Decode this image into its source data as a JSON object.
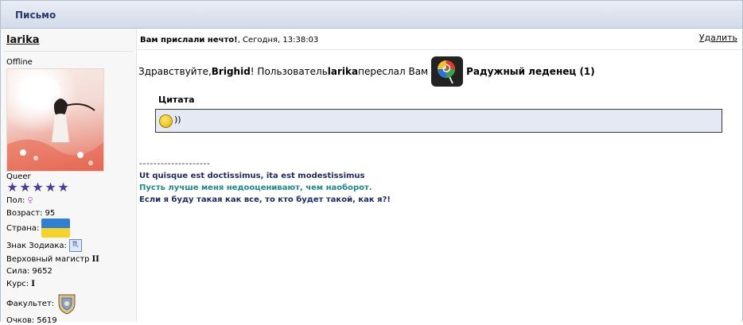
{
  "panel": {
    "title": "Письмо"
  },
  "sender": {
    "username": "larika",
    "status": "Offline",
    "rank": "Queer",
    "stars_count": 5,
    "gender_label": "Пол:",
    "gender_icon": "female-sign",
    "age_label": "Возраст:",
    "age_value": "95",
    "country_label": "Страна:",
    "country_flag": "ukraine-flag",
    "zodiac_label": "Знак Зодиака:",
    "zodiac_symbol": "♏",
    "title_text": "Верховный магистр",
    "title_level": "II",
    "power_label": "Сила:",
    "power_value": "9652",
    "course_label": "Курс:",
    "course_value": "I",
    "faculty_label": "Факультет:",
    "faculty_icon": "faculty-crest",
    "points_label": "Очков:",
    "points_value": "5619"
  },
  "message": {
    "subject": "Вам прислали нечто!",
    "date": ", Сегодня, 13:38:03",
    "delete_label": "Удалить",
    "greeting_prefix": "Здравствуйте, ",
    "recipient": "Brighid",
    "greeting_middle": "! Пользователь ",
    "sender_name": "larika",
    "greeting_suffix": " переслал Вам",
    "gift_name": "Радужный леденец (1)",
    "gift_icon": "rainbow-lollipop",
    "quote_label": "Цитата",
    "quote_text": "))",
    "signature_divider": "--------------------",
    "signature_lines": [
      "Ut quisque est doctissimus, ita est modestissimus",
      "Пусть лучше меня недооценивают, чем наоборот.",
      "Если я буду такая как все, то кто будет такой, как я?!"
    ]
  },
  "colors": {
    "header_text": "#2a3b6b",
    "signature_dark": "#1e2b66",
    "signature_teal": "#1c8a8a",
    "quote_bg": "#e4e9f4",
    "star": "#4a3e9a"
  }
}
